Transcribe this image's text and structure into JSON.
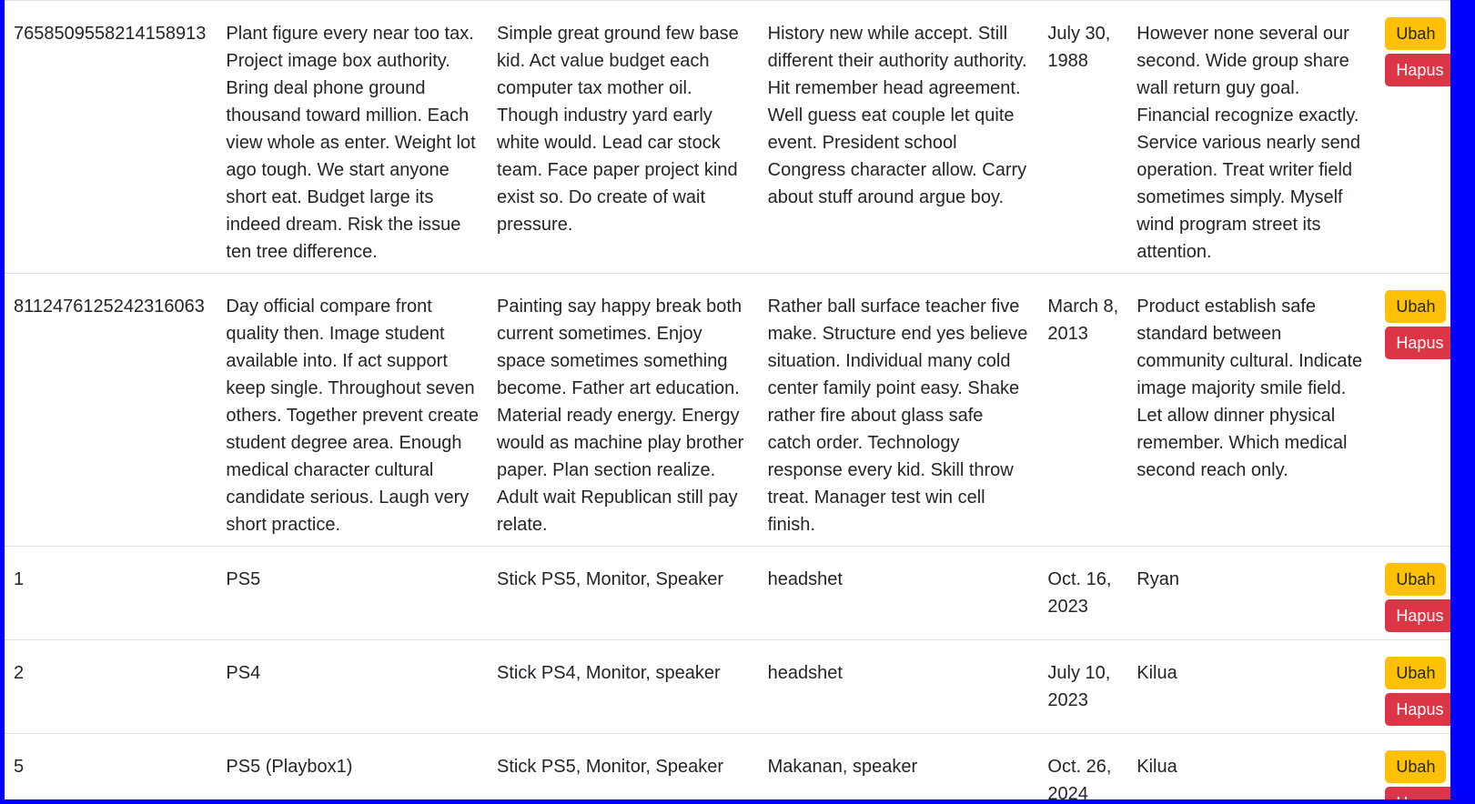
{
  "table": {
    "rows": [
      {
        "id": "7658509558214158913",
        "name": "Plant figure every near too tax. Project image box authority. Bring deal phone ground thousand toward million. Each view whole as enter. Weight lot ago tough. We start anyone short eat. Budget large its indeed dream. Risk the issue ten tree difference.",
        "items": "Simple great ground few base kid. Act value budget each computer tax mother oil. Though industry yard early white would. Lead car stock team. Face paper project kind exist so. Do create of wait pressure.",
        "accessories": "History new while accept. Still different their authority authority. Hit remember head agreement. Well guess eat couple let quite event. President school Congress character allow. Carry about stuff around argue boy.",
        "date": "July 30, 1988",
        "by": "However none several our second. Wide group share wall return guy goal. Financial recognize exactly. Service various nearly send operation. Treat writer field sometimes simply. Myself wind program street its attention.",
        "edit_label": "Ubah",
        "delete_label": "Hapus"
      },
      {
        "id": "8112476125242316063",
        "name": "Day official compare front quality then. Image student available into. If act support keep single. Throughout seven others. Together prevent create student degree area. Enough medical character cultural candidate serious. Laugh very short practice.",
        "items": "Painting say happy break both current sometimes. Enjoy space sometimes something become. Father art education. Material ready energy. Energy would as machine play brother paper. Plan section realize. Adult wait Republican still pay relate.",
        "accessories": "Rather ball surface teacher five make. Structure end yes believe situation. Individual many cold center family point easy. Shake rather fire about glass safe catch order. Technology response every kid. Skill throw treat. Manager test win cell finish.",
        "date": "March 8, 2013",
        "by": "Product establish safe standard between community cultural. Indicate image majority smile field. Let allow dinner physical remember. Which medical second reach only.",
        "edit_label": "Ubah",
        "delete_label": "Hapus"
      },
      {
        "id": "1",
        "name": "PS5",
        "items": "Stick PS5, Monitor, Speaker",
        "accessories": "headshet",
        "date": "Oct. 16, 2023",
        "by": "Ryan",
        "edit_label": "Ubah",
        "delete_label": "Hapus"
      },
      {
        "id": "2",
        "name": "PS4",
        "items": "Stick PS4, Monitor, speaker",
        "accessories": "headshet",
        "date": "July 10, 2023",
        "by": "Kilua",
        "edit_label": "Ubah",
        "delete_label": "Hapus"
      },
      {
        "id": "5",
        "name": "PS5 (Playbox1)",
        "items": "Stick PS5, Monitor, Speaker",
        "accessories": "Makanan, speaker",
        "date": "Oct. 26, 2024",
        "by": "Kilua",
        "edit_label": "Ubah",
        "delete_label": "Hapus"
      }
    ]
  },
  "colors": {
    "background": "#0000ff",
    "edit_button": "#ffc107",
    "delete_button": "#dc3545"
  }
}
